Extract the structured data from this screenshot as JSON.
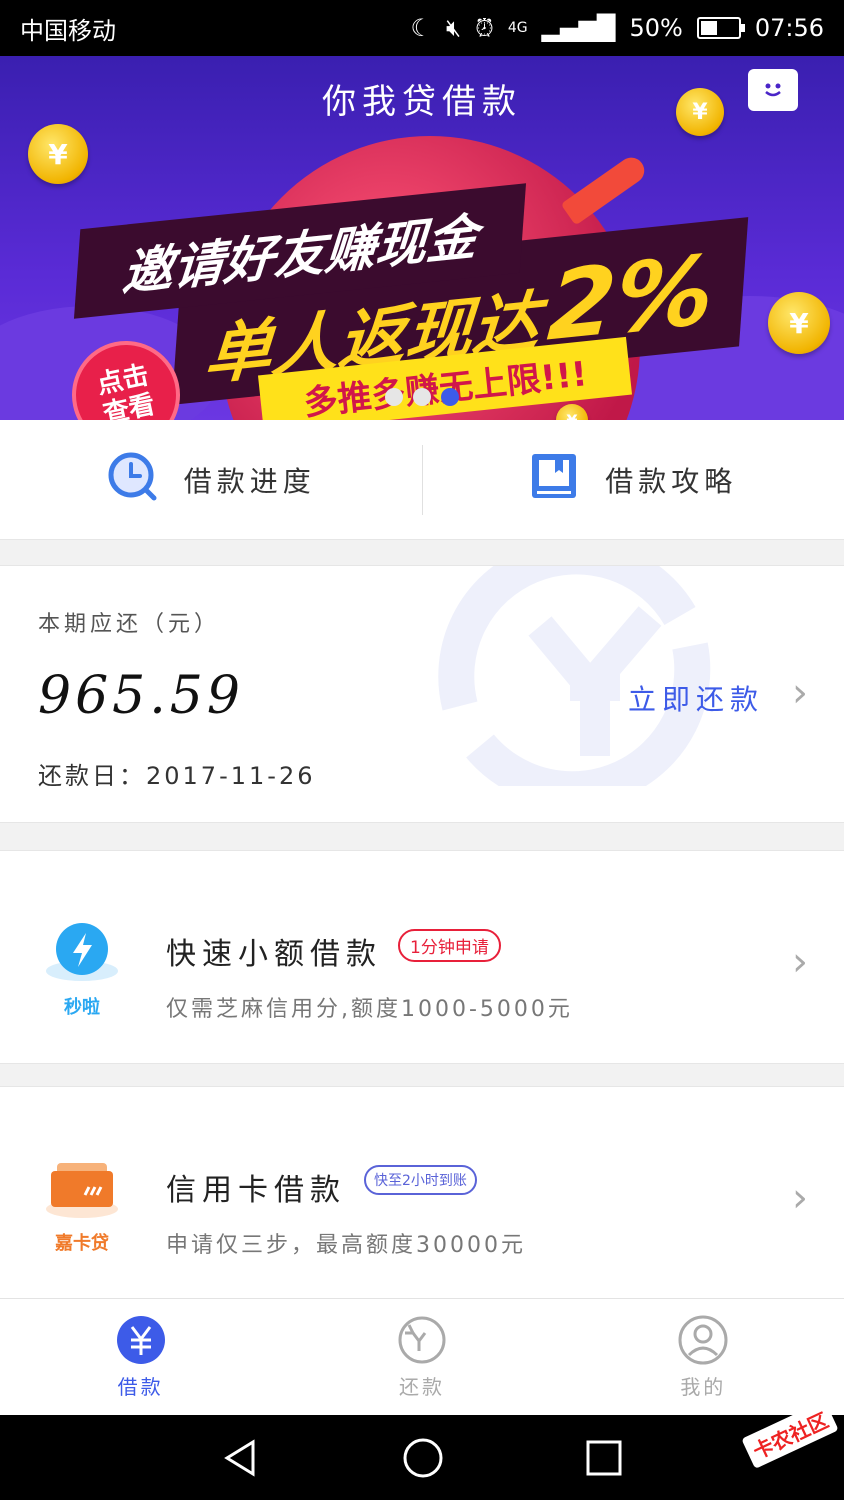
{
  "status_bar": {
    "carrier": "中国移动",
    "network": "4G",
    "battery_percent": "50%",
    "battery_level": 0.5,
    "time": "07:56"
  },
  "banner": {
    "title": "你我贷借款",
    "line1": "邀请好友赚现金",
    "line2_prefix": "单人返现达",
    "line2_big": "2%",
    "line3": "多推多赚无上限!!!",
    "badge": "点击查看",
    "coin_symbol": "¥",
    "page_count": 3,
    "active_page": 3
  },
  "quick_links": [
    {
      "label": "借款进度",
      "icon": "clock-icon"
    },
    {
      "label": "借款攻略",
      "icon": "book-icon"
    }
  ],
  "repay_card": {
    "label": "本期应还（元）",
    "amount": "965.59",
    "date_label": "还款日：",
    "date": "2017-11-26",
    "action": "立即还款"
  },
  "products": [
    {
      "name": "快速小额借款",
      "tag": "1分钟申请",
      "tag_color": "#e8203a",
      "desc": "仅需芝麻信用分,额度1000-5000元",
      "logo_text": "秒啦",
      "logo_color": "#2aa8f2",
      "icon": "lightning-icon"
    },
    {
      "name": "信用卡借款",
      "tag": "快至2小时到账",
      "tag_color": "#5a63d8",
      "desc": "申请仅三步，最高额度30000元",
      "logo_text": "嘉卡贷",
      "logo_color": "#f07a2a",
      "icon": "credit-card-icon"
    }
  ],
  "tabbar": [
    {
      "label": "借款",
      "icon": "yuan-icon",
      "active": true
    },
    {
      "label": "还款",
      "icon": "repay-icon",
      "active": false
    },
    {
      "label": "我的",
      "icon": "user-icon",
      "active": false
    }
  ],
  "colors": {
    "accent": "#3d5be8",
    "banner_bg": "#4a25c8"
  },
  "watermark": "卡农社区"
}
